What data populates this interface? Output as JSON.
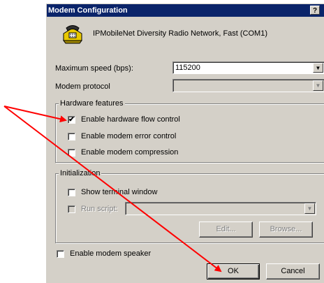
{
  "window": {
    "title": "Modem Configuration",
    "help_label": "?"
  },
  "device": {
    "name": "IPMobileNet Diversity Radio Network, Fast (COM1)"
  },
  "max_speed": {
    "label": "Maximum speed (bps):",
    "value": "115200"
  },
  "protocol": {
    "label": "Modem protocol",
    "value": ""
  },
  "hardware": {
    "legend": "Hardware features",
    "items": [
      {
        "label": "Enable hardware flow control",
        "checked": true
      },
      {
        "label": "Enable modem error control",
        "checked": false
      },
      {
        "label": "Enable modem compression",
        "checked": false
      }
    ]
  },
  "initialization": {
    "legend": "Initialization",
    "show_terminal": {
      "label": "Show terminal window",
      "checked": false
    },
    "run_script": {
      "label": "Run script:",
      "checked": false,
      "value": ""
    },
    "edit_label": "Edit...",
    "browse_label": "Browse..."
  },
  "speaker": {
    "label": "Enable modem speaker",
    "checked": false
  },
  "buttons": {
    "ok": "OK",
    "cancel": "Cancel"
  },
  "colors": {
    "titlebar": "#0a246a",
    "face": "#d4d0c8",
    "annotation": "#ff0000"
  },
  "icons": {
    "modem": "modem-phone-icon",
    "check": "✔"
  }
}
